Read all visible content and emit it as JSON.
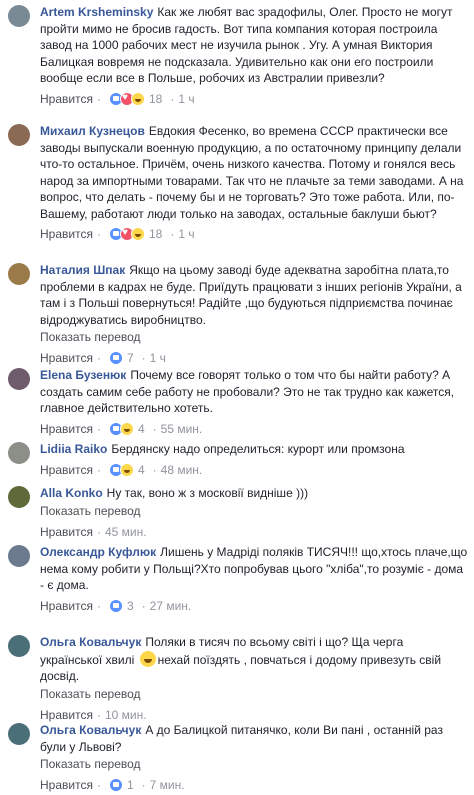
{
  "common": {
    "like_label": "Нравится",
    "translate_label": "Показать перевод",
    "dot": "·"
  },
  "comments": [
    {
      "author": "Artem Krsheminsky",
      "text": "Как же любят вас зрадофилы, Олег. Просто не могут пройти мимо не бросив гадость. Вот типа компания которая построила завод на 1000 рабочих мест не изучила рынок . Угу. А умная Виктория Балицкая вовремя не подсказала. Удивительно как они его построили вообще если все в Польше, робочих из Австралии привезли?",
      "reaction_count": "18",
      "time": "1 ч",
      "avatar_color": "#7a8a94"
    },
    {
      "author": "Михаил Кузнецов",
      "text": "Евдокия Фесенко, во времена СССР практически все заводы выпускали военную продукцию, а по остаточному принципу делали что-то остальное. Причём, очень низкого качества. Потому и гонялся весь народ за импортными товарами. Так что не плачьте за теми заводами. А на вопрос, что делать - почему бы и не торговать? Это тоже работа. Или, по-Вашему, работают люди только на заводах, остальные баклуши бьют?",
      "reaction_count": "18",
      "time": "1 ч",
      "avatar_color": "#8a6a55"
    },
    {
      "author": "Наталия Шпак",
      "text": "Якщо на цьому заводі буде адекватна заробітна плата,то проблеми в кадрах не буде. Приїдуть працювати з інших регіонів України, а там і з Польші повернуться! Радійте ,що будуються підприємства починає відроджуватись виробництво.",
      "reaction_count": "7",
      "time": "1 ч",
      "avatar_color": "#9a7a48"
    },
    {
      "author": "Elena Бузенюк",
      "text": "Почему все говорят только о том что бы найти работу? А создать самим себе работу не пробовали? Это не так трудно как кажется, главное действительно хотеть.",
      "reaction_count": "4",
      "time": "55 мин.",
      "avatar_color": "#6e5c6a"
    },
    {
      "author": "Lidiia Raiko",
      "text": "Бердянску надо определиться: курорт или промзона",
      "reaction_count": "4",
      "time": "48 мин.",
      "avatar_color": "#8c8f88"
    },
    {
      "author": "Alla Konko",
      "text": "Ну так, воно ж з московії видніше )))",
      "time": "45 мин.",
      "avatar_color": "#5e6a3a"
    },
    {
      "author": "Олександр Куфлюк",
      "text": "Лишень у Мадріді поляків ТИСЯЧ!!! що,хтось плаче,що нема кому робити у Польщі?Хто попробував цього \"хліба\",то розуміє - дома - є дома.",
      "reaction_count": "3",
      "time": "27 мин.",
      "avatar_color": "#6b7a8c"
    },
    {
      "author": "Ольга Ковальчук",
      "text_before": "Поляки в тисяч по всьому світі і що? Ща черга української хвилі",
      "text_after": "нехай поїздять , повчаться і додому привезуть свій досвід.",
      "time": "10 мин.",
      "avatar_color": "#4a6f78"
    },
    {
      "author": "Ольга Ковальчук",
      "text": "А до Балицкой питанячко, коли Ви пані , останній раз були у Львові?",
      "reaction_count": "1",
      "time": "7 мин.",
      "avatar_color": "#4a6f78"
    }
  ]
}
